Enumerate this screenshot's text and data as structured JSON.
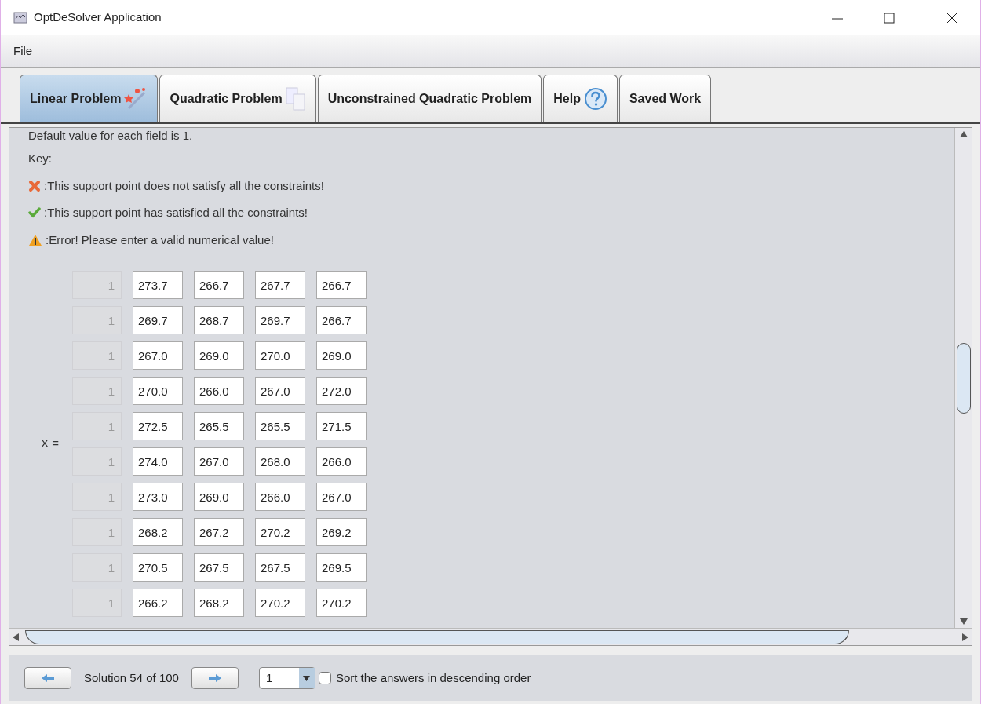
{
  "window": {
    "title": "OptDeSolver Application"
  },
  "menu": [
    "File"
  ],
  "tabs": [
    {
      "label": "Linear Problem",
      "kind": "wand",
      "selected": true
    },
    {
      "label": "Quadratic Problem",
      "kind": "pages",
      "selected": false
    },
    {
      "label": "Unconstrained Quadratic Problem",
      "kind": "plain",
      "selected": false
    },
    {
      "label": "Help",
      "kind": "help",
      "selected": false
    },
    {
      "label": "Saved Work",
      "kind": "plain",
      "selected": false
    }
  ],
  "intro": "Default value for each field is 1.",
  "key_title": "Key:",
  "key": [
    {
      "kind": "error",
      "text": ":This support point does not satisfy all the constraints!"
    },
    {
      "kind": "ok",
      "text": ":This support point has satisfied all the constraints!"
    },
    {
      "kind": "warning",
      "text": ":Error! Please enter a valid numerical value!"
    }
  ],
  "matrix_label": "X =",
  "matrix": [
    {
      "constant": "1",
      "values": [
        "273.7",
        "266.7",
        "267.7",
        "266.7"
      ]
    },
    {
      "constant": "1",
      "values": [
        "269.7",
        "268.7",
        "269.7",
        "266.7"
      ]
    },
    {
      "constant": "1",
      "values": [
        "267.0",
        "269.0",
        "270.0",
        "269.0"
      ]
    },
    {
      "constant": "1",
      "values": [
        "270.0",
        "266.0",
        "267.0",
        "272.0"
      ]
    },
    {
      "constant": "1",
      "values": [
        "272.5",
        "265.5",
        "265.5",
        "271.5"
      ]
    },
    {
      "constant": "1",
      "values": [
        "274.0",
        "267.0",
        "268.0",
        "266.0"
      ]
    },
    {
      "constant": "1",
      "values": [
        "273.0",
        "269.0",
        "266.0",
        "267.0"
      ]
    },
    {
      "constant": "1",
      "values": [
        "268.2",
        "267.2",
        "270.2",
        "269.2"
      ]
    },
    {
      "constant": "1",
      "values": [
        "270.5",
        "267.5",
        "267.5",
        "269.5"
      ]
    },
    {
      "constant": "1",
      "values": [
        "266.2",
        "268.2",
        "270.2",
        "270.2"
      ]
    }
  ],
  "footer": {
    "solution": "Solution 54 of 100",
    "dropdown": "1",
    "sort": {
      "label": "Sort the answers in descending order",
      "checked": false
    }
  }
}
